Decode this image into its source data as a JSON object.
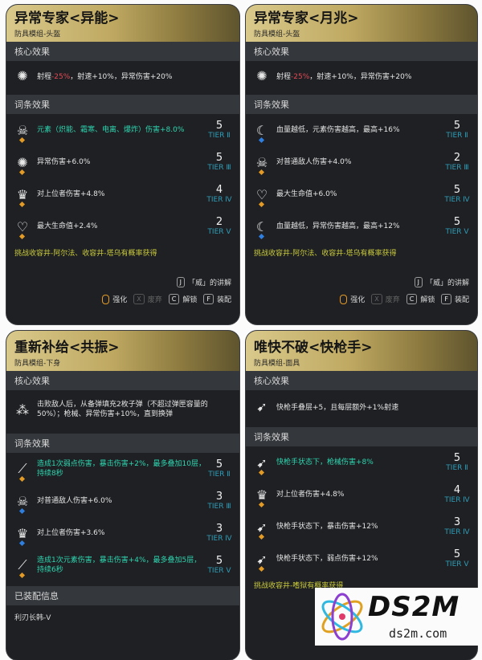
{
  "cards": [
    {
      "title": "异常专家<异能>",
      "subtitle": "防具模组-头盔",
      "core_header": "核心效果",
      "core": {
        "icon": "swirl-icon",
        "pre": "射程",
        "red": "-25%",
        "post": "，射速+10%，异常伤害+20%"
      },
      "entries_header": "词条效果",
      "entries": [
        {
          "icon": "skull-icon",
          "dot": "orange",
          "text": "元素（炽能、霜寒、电离、爆炸）伤害+8.0%",
          "teal": true,
          "num": "5",
          "tier": "TIER Ⅱ"
        },
        {
          "icon": "swirl-icon",
          "dot": "orange",
          "text": "异常伤害+6.0%",
          "teal": false,
          "num": "5",
          "tier": "TIER Ⅲ"
        },
        {
          "icon": "crown-icon",
          "dot": "orange",
          "text": "对上位者伤害+4.8%",
          "teal": false,
          "num": "4",
          "tier": "TIER Ⅳ"
        },
        {
          "icon": "heart-icon",
          "dot": "orange",
          "text": "最大生命值+2.4%",
          "teal": false,
          "num": "2",
          "tier": "TIER Ⅴ"
        }
      ],
      "challenge": "挑战收容井-阿尔法、收容井-塔乌有概率获得",
      "explain": "「威」的讲解"
    },
    {
      "title": "异常专家<月兆>",
      "subtitle": "防具模组-头盔",
      "core_header": "核心效果",
      "core": {
        "icon": "swirl-icon",
        "pre": "射程",
        "red": "-25%",
        "post": "，射速+10%，异常伤害+20%"
      },
      "entries_header": "词条效果",
      "entries": [
        {
          "icon": "moon-icon",
          "dot": "blue",
          "text": "血量越低，元素伤害越高，最高+16%",
          "teal": false,
          "num": "5",
          "tier": "TIER Ⅱ"
        },
        {
          "icon": "skull-icon",
          "dot": "orange",
          "text": "对普通敌人伤害+4.0%",
          "teal": false,
          "num": "2",
          "tier": "TIER Ⅲ"
        },
        {
          "icon": "heart-icon",
          "dot": "orange",
          "text": "最大生命值+6.0%",
          "teal": false,
          "num": "5",
          "tier": "TIER Ⅳ"
        },
        {
          "icon": "moon-icon",
          "dot": "blue",
          "text": "血量越低，异常伤害越高，最高+12%",
          "teal": false,
          "num": "5",
          "tier": "TIER Ⅴ"
        }
      ],
      "challenge": "挑战收容井-阿尔法、收容井-塔乌有概率获得",
      "explain": "「威」的讲解"
    },
    {
      "title": "重新补给<共振>",
      "subtitle": "防具模组-下身",
      "core_header": "核心效果",
      "core": {
        "icon": "bullets-icon",
        "pre": "击败敌人后，从备弹填充2枚子弹（不超过弹匣容量的50%）；枪械、异常伤害+10%，直到换弹",
        "red": "",
        "post": ""
      },
      "entries_header": "词条效果",
      "entries": [
        {
          "icon": "slash-icon",
          "dot": "orange",
          "text": "造成1次弱点伤害，暴击伤害+2%，最多叠加10层，持续8秒",
          "teal": true,
          "num": "5",
          "tier": "TIER Ⅱ"
        },
        {
          "icon": "skull-icon",
          "dot": "blue",
          "text": "对普通敌人伤害+6.0%",
          "teal": false,
          "num": "3",
          "tier": "TIER Ⅲ"
        },
        {
          "icon": "crown-icon",
          "dot": "blue",
          "text": "对上位者伤害+3.6%",
          "teal": false,
          "num": "3",
          "tier": "TIER Ⅳ"
        },
        {
          "icon": "slash-icon",
          "dot": "orange",
          "text": "造成1次元素伤害，暴击伤害+4%，最多叠加5层，持续6秒",
          "teal": true,
          "num": "5",
          "tier": "TIER Ⅴ"
        }
      ],
      "equipped_header": "已装配信息",
      "equipped": "利刃长韩-V"
    },
    {
      "title": "唯快不破<快枪手>",
      "subtitle": "防具模组-面具",
      "core_header": "核心效果",
      "core": {
        "icon": "bullet-icon",
        "pre": "快枪手叠层+5，且每层额外+1%射速",
        "red": "",
        "post": ""
      },
      "entries_header": "词条效果",
      "entries": [
        {
          "icon": "bullet-icon",
          "dot": "orange",
          "text": "快枪手状态下，枪械伤害+8%",
          "teal": true,
          "num": "5",
          "tier": "TIER Ⅱ"
        },
        {
          "icon": "crown-icon",
          "dot": "orange",
          "text": "对上位者伤害+4.8%",
          "teal": false,
          "num": "4",
          "tier": "TIER Ⅳ"
        },
        {
          "icon": "bullet-icon",
          "dot": "orange",
          "text": "快枪手状态下，暴击伤害+12%",
          "teal": false,
          "num": "3",
          "tier": "TIER Ⅳ"
        },
        {
          "icon": "bullet-icon",
          "dot": "orange",
          "text": "快枪手状态下，弱点伤害+12%",
          "teal": false,
          "num": "5",
          "tier": "TIER Ⅴ"
        }
      ],
      "challenge": "挑战收容井-嗜狱有概率获得"
    }
  ],
  "keys": {
    "j": "J",
    "x": "X",
    "c": "C",
    "f": "F"
  },
  "actions": {
    "enhance": "强化",
    "discard": "废弃",
    "unlock": "解锁",
    "equip": "装配"
  },
  "watermark": {
    "logo": "DS2M",
    "url": "ds2m.com"
  },
  "colors": {
    "accent_red": "#e04a55",
    "accent_teal": "#2fd5b0",
    "tier_blue": "#2f9db8",
    "challenge_yellow": "#c8c83c"
  }
}
